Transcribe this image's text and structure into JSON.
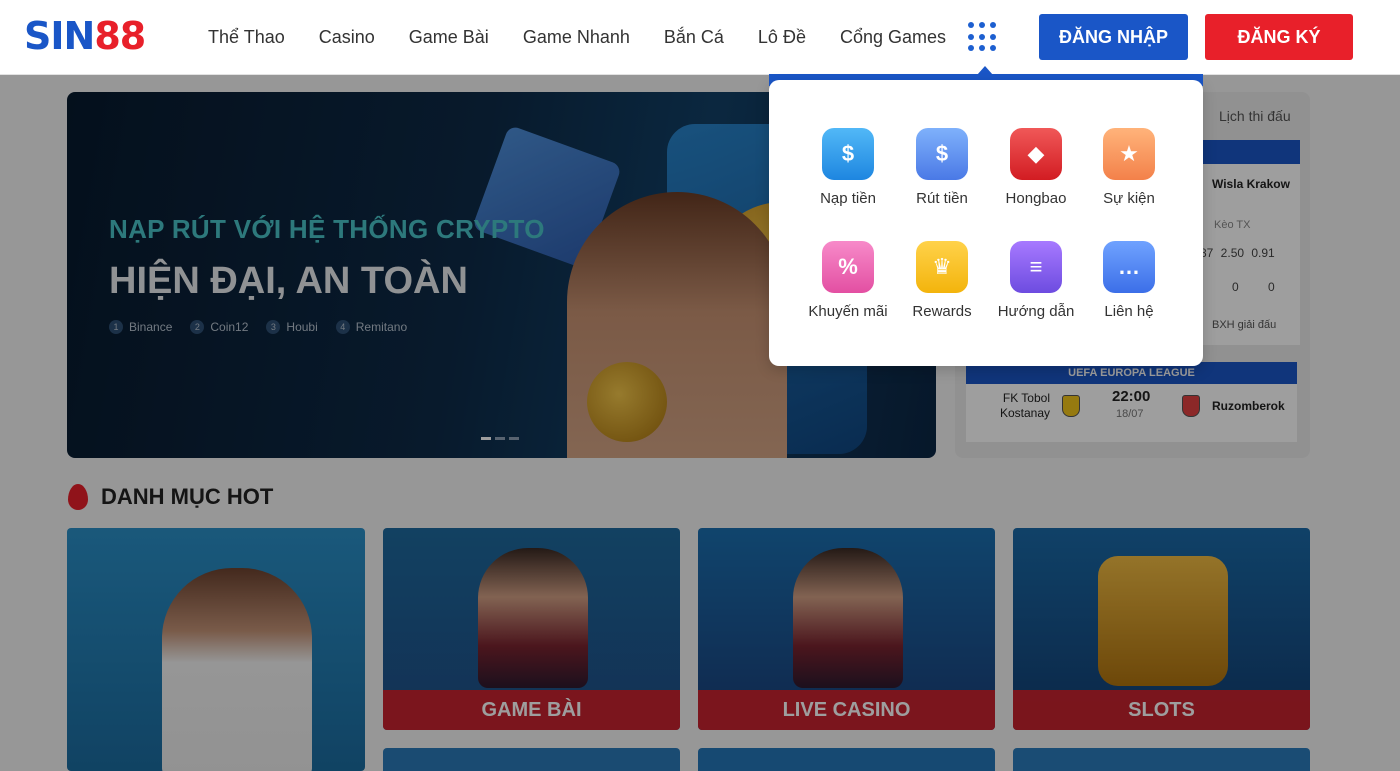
{
  "header": {
    "logo": {
      "part1": "SIN",
      "part2": "88"
    },
    "nav": [
      "Thể Thao",
      "Casino",
      "Game Bài",
      "Game Nhanh",
      "Bắn Cá",
      "Lô Đề",
      "Cổng Games"
    ],
    "login_label": "ĐĂNG NHẬP",
    "register_label": "ĐĂNG KÝ",
    "menu_icon": "grid-icon",
    "colors": {
      "blue": "#1a56c7",
      "red": "#e8202a"
    }
  },
  "dropdown": {
    "items": [
      {
        "label": "Nạp tiền",
        "icon": "deposit-icon",
        "glyph": "$"
      },
      {
        "label": "Rút tiền",
        "icon": "withdraw-icon",
        "glyph": "$"
      },
      {
        "label": "Hongbao",
        "icon": "red-envelope-icon",
        "glyph": "◆"
      },
      {
        "label": "Sự kiện",
        "icon": "calendar-icon",
        "glyph": "★"
      },
      {
        "label": "Khuyến mãi",
        "icon": "promotion-icon",
        "glyph": "%"
      },
      {
        "label": "Rewards",
        "icon": "crown-icon",
        "glyph": "♛"
      },
      {
        "label": "Hướng dẫn",
        "icon": "guide-icon",
        "glyph": "≡"
      },
      {
        "label": "Liên hệ",
        "icon": "chat-icon",
        "glyph": "…"
      }
    ]
  },
  "banner": {
    "subtitle": "NẠP RÚT VỚI HỆ THỐNG CRYPTO",
    "title": "HIỆN ĐẠI, AN TOÀN",
    "list": [
      {
        "num": "1",
        "name": "Binance"
      },
      {
        "num": "2",
        "name": "Coin12"
      },
      {
        "num": "3",
        "name": "Houbi"
      },
      {
        "num": "4",
        "name": "Remitano"
      }
    ]
  },
  "schedule": {
    "tab": "Lịch thi đấu",
    "match1": {
      "team_right": "Wisla Krakow",
      "odds_header": "Kèo TX",
      "odds": "87 2.50 0.91",
      "zeros": "0 0 0"
    },
    "standings": "BXH giải đấu",
    "match2": {
      "league": "UEFA EUROPA LEAGUE",
      "team_left": "FK Tobol Kostanay",
      "time": "22:00",
      "date": "18/07",
      "team_right": "Ruzomberok"
    }
  },
  "hot": {
    "title": "DANH MỤC HOT",
    "tiles": [
      "GAME BÀI",
      "LIVE CASINO",
      "SLOTS"
    ]
  }
}
